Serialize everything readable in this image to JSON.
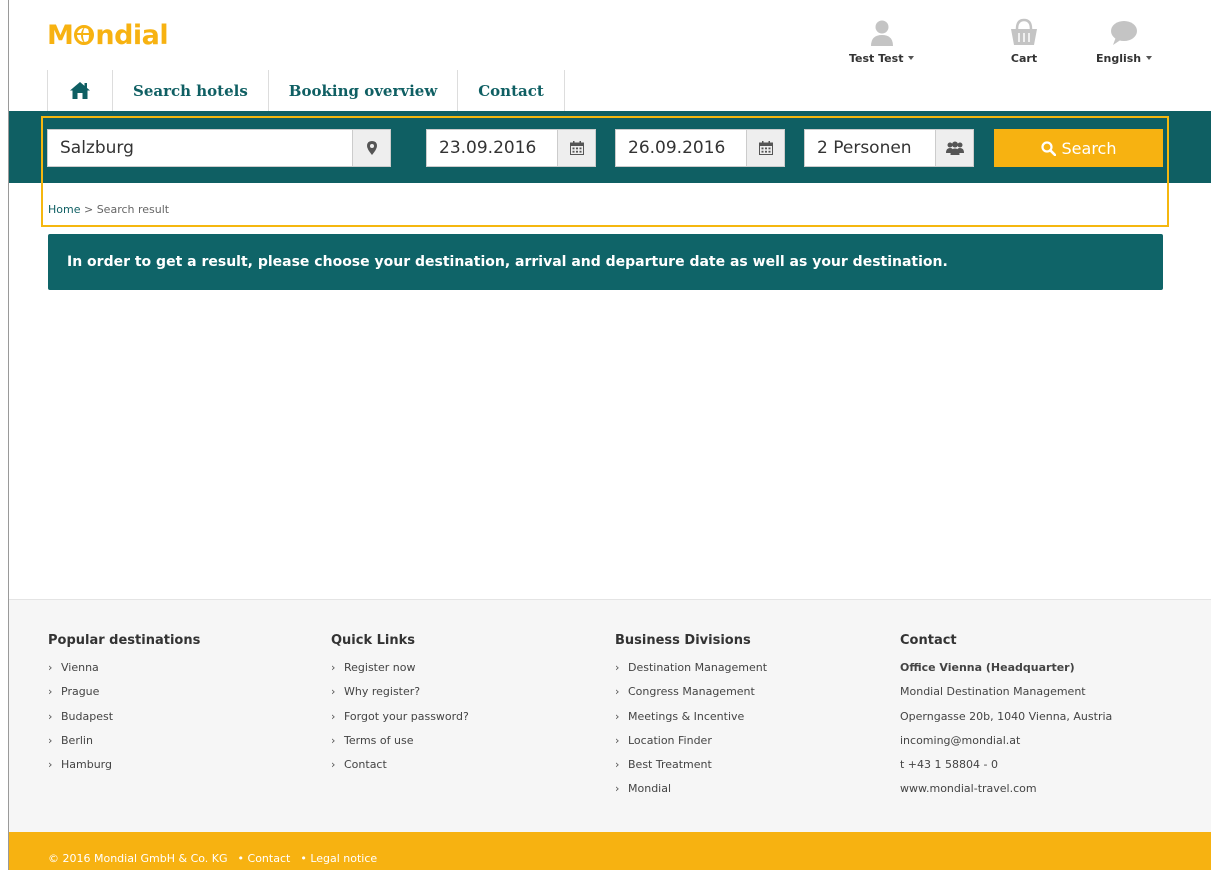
{
  "brand": {
    "logo_pre": "M",
    "logo_post": "ndial",
    "accent": "#f7b211",
    "primary": "#0f5f63"
  },
  "nav": {
    "home_icon": "home-icon",
    "items": [
      {
        "label": "Search hotels"
      },
      {
        "label": "Booking overview"
      },
      {
        "label": "Contact"
      }
    ]
  },
  "header": {
    "user": {
      "icon": "user-icon",
      "label": "Test Test"
    },
    "cart": {
      "icon": "basket-icon",
      "label": "Cart"
    },
    "language": {
      "icon": "speech-bubble-icon",
      "label": "English"
    }
  },
  "search": {
    "destination": {
      "value": "Salzburg",
      "icon": "map-marker-icon"
    },
    "arrival": {
      "value": "23.09.2016",
      "icon": "calendar-icon"
    },
    "departure": {
      "value": "26.09.2016",
      "icon": "calendar-icon"
    },
    "persons": {
      "value": "2 Personen",
      "icon": "group-icon"
    },
    "button": {
      "label": "Search",
      "icon": "search-icon"
    }
  },
  "breadcrumb": {
    "home": "Home",
    "separator": ">",
    "current": "Search result"
  },
  "notice": "In order to get a result, please choose your destination, arrival and departure date as well as your destination.",
  "footer": {
    "popular": {
      "title": "Popular destinations",
      "items": [
        "Vienna",
        "Prague",
        "Budapest",
        "Berlin",
        "Hamburg"
      ]
    },
    "quick": {
      "title": "Quick Links",
      "items": [
        "Register now",
        "Why register?",
        "Forgot your password?",
        "Terms of use",
        "Contact"
      ]
    },
    "business": {
      "title": "Business Divisions",
      "items": [
        "Destination Management",
        "Congress Management",
        "Meetings & Incentive",
        "Location Finder",
        "Best Treatment",
        "Mondial"
      ]
    },
    "contact": {
      "title": "Contact",
      "office": "Office Vienna (Headquarter)",
      "company": "Mondial Destination Management",
      "address": "Operngasse 20b, 1040 Vienna, Austria",
      "email": "incoming@mondial.at",
      "phone": "t +43 1 58804 - 0",
      "web": "www.mondial-travel.com"
    }
  },
  "bottombar": {
    "copyright": "© 2016 Mondial GmbH & Co. KG",
    "link_contact": "• Contact",
    "link_legal": "• Legal notice"
  }
}
